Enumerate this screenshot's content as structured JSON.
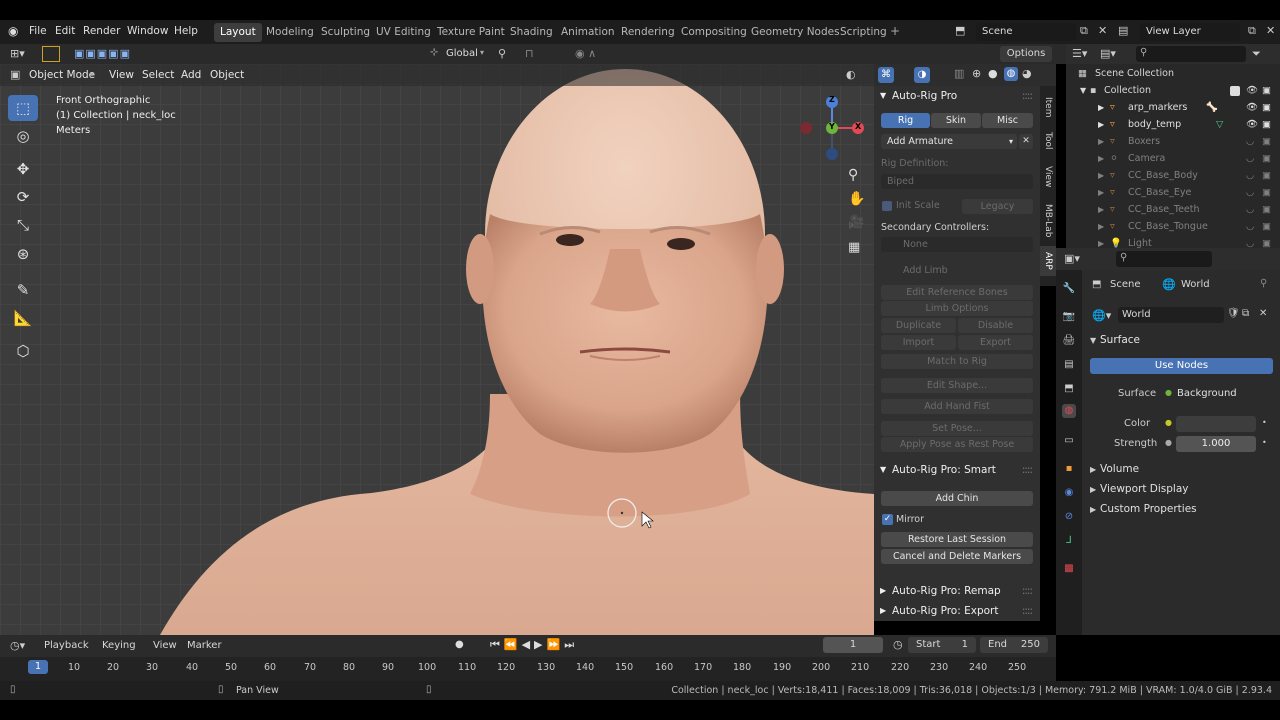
{
  "menubar": {
    "items": [
      "File",
      "Edit",
      "Render",
      "Window",
      "Help"
    ],
    "workspaces": [
      "Layout",
      "Modeling",
      "Sculpting",
      "UV Editing",
      "Texture Paint",
      "Shading",
      "Animation",
      "Rendering",
      "Compositing",
      "Geometry Nodes",
      "Scripting"
    ],
    "active_workspace": "Layout",
    "scene": "Scene",
    "view_layer": "View Layer"
  },
  "viewport_header": {
    "mode": "Object Mode",
    "menus": [
      "View",
      "Select",
      "Add",
      "Object"
    ],
    "transform_orientation": "Global",
    "options_label": "Options"
  },
  "viewport_overlay": {
    "view_name": "Front Orthographic",
    "collection_info": "(1) Collection | neck_loc",
    "units": "Meters"
  },
  "gizmo": {
    "z": "Z",
    "y": "Y",
    "x": "X"
  },
  "sidebar_tabs": [
    "Item",
    "Tool",
    "View",
    "MB-Lab",
    "ARP"
  ],
  "arp": {
    "title": "Auto-Rig Pro",
    "tabs": [
      "Rig",
      "Skin",
      "Misc"
    ],
    "active_tab": "Rig",
    "add_armature": "Add Armature",
    "rig_definition_label": "Rig Definition:",
    "rig_definition_value": "Biped",
    "init_scale": "Init Scale",
    "legacy": "Legacy",
    "secondary_label": "Secondary Controllers:",
    "secondary_value": "None",
    "add_limb": "Add Limb",
    "edit_reference_bones": "Edit Reference Bones",
    "limb_options": "Limb Options",
    "duplicate": "Duplicate",
    "disable": "Disable",
    "import": "Import",
    "export": "Export",
    "match_to_rig": "Match to Rig",
    "edit_shape": "Edit Shape...",
    "add_hand_fist": "Add Hand Fist",
    "set_pose": "Set Pose...",
    "apply_pose": "Apply Pose as Rest Pose",
    "smart_title": "Auto-Rig Pro: Smart",
    "add_chin": "Add Chin",
    "mirror": "Mirror",
    "restore_session": "Restore Last Session",
    "cancel_markers": "Cancel and Delete Markers",
    "remap_title": "Auto-Rig Pro: Remap",
    "export_title": "Auto-Rig Pro: Export"
  },
  "outliner": {
    "root": "Scene Collection",
    "collection": "Collection",
    "items": [
      "arp_markers",
      "body_temp",
      "Boxers",
      "Camera",
      "CC_Base_Body",
      "CC_Base_Eye",
      "CC_Base_Teeth",
      "CC_Base_Tongue",
      "Light"
    ]
  },
  "properties": {
    "scene_tab": "Scene",
    "world_tab": "World",
    "world_name": "World",
    "surface_panel": "Surface",
    "use_nodes": "Use Nodes",
    "surface_label": "Surface",
    "surface_value": "Background",
    "color_label": "Color",
    "strength_label": "Strength",
    "strength_value": "1.000",
    "volume": "Volume",
    "viewport_display": "Viewport Display",
    "custom_properties": "Custom Properties"
  },
  "timeline": {
    "menus": [
      "Playback",
      "Keying",
      "View",
      "Marker"
    ],
    "current_frame": "1",
    "start_label": "Start",
    "start_value": "1",
    "end_label": "End",
    "end_value": "250",
    "ruler": [
      "1",
      "10",
      "20",
      "30",
      "40",
      "50",
      "60",
      "70",
      "80",
      "90",
      "100",
      "110",
      "120",
      "130",
      "140",
      "150",
      "160",
      "170",
      "180",
      "190",
      "200",
      "210",
      "220",
      "230",
      "240",
      "250"
    ]
  },
  "statusbar": {
    "hint": "Pan View",
    "stats": "Collection | neck_loc | Verts:18,411 | Faces:18,009 | Tris:36,018 | Objects:1/3 | Memory: 791.2 MiB | VRAM: 1.0/4.0 GiB | 2.93.4"
  },
  "colors": {
    "accent": "#4772b3",
    "background": "#303030",
    "skin": "#d9a48a"
  }
}
